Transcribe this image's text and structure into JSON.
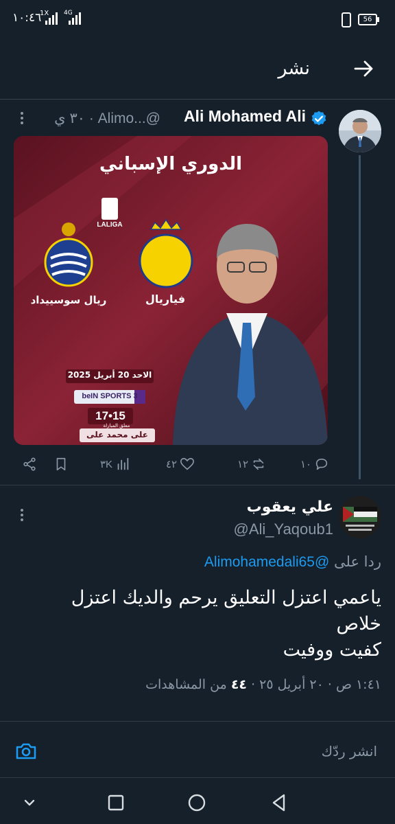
{
  "status_bar": {
    "time": "١٠:٤٦",
    "net_1": "1X",
    "net_2": "4G",
    "battery": "56"
  },
  "header": {
    "title": "نشر"
  },
  "tweet": {
    "author_name": "Ali Mohamed Ali",
    "handle_time": "٣٠ ي · Alimo...@",
    "media": {
      "headline": "الدوري الإسباني",
      "league": "LALIGA",
      "team_right": "فياريال",
      "team_left": "ريال سوسييداد",
      "date": "الاحد 20 أبريل 2025",
      "channel": "beIN SPORTS 3",
      "time": "17•15",
      "commentary_label": "معلق المباراة",
      "commentator": "على محمد على"
    },
    "actions": {
      "views": "٣K",
      "likes": "٤٢",
      "retweets": "١٢",
      "replies": "١٠"
    }
  },
  "reply": {
    "author_name": "علي يعقوب",
    "handle": "@Ali_Yaqoub1",
    "replying_label": "ردا على",
    "replying_to": "@Alimohamedali65",
    "body_line1": "ياعمي اعتزل التعليق يرحم والديك اعتزل",
    "body_line2": "خلاص",
    "body_line3": "كفيت ووفيت",
    "meta_time": "١:٤١ ص · ٢٠ أبريل ٢٥ ·",
    "meta_views": "٤٤",
    "meta_views_label": "من المشاهدات"
  },
  "composer": {
    "placeholder": "انشر ردّك"
  },
  "colors": {
    "background": "#15202b",
    "accent": "#1d9bf0",
    "muted": "#8b98a5"
  }
}
